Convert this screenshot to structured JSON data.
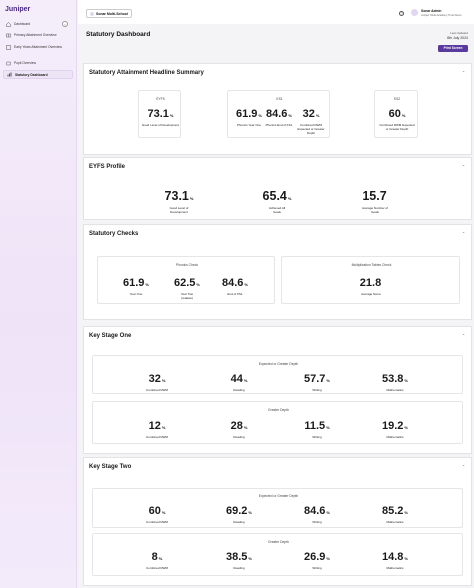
{
  "app": {
    "logo": "Juniper"
  },
  "sidebar": {
    "collapse_icon": "chevron-left-icon",
    "items": [
      {
        "label": "Dashboard",
        "icon": "home-icon"
      },
      {
        "label": "Primary Attainment Overview",
        "icon": "book-icon"
      },
      {
        "label": "Early Years Attainment Overview",
        "icon": "blocks-icon"
      },
      {
        "label": "Pupil Overview",
        "icon": "people-icon"
      },
      {
        "label": "Statutory Dashboard",
        "icon": "chart-icon"
      }
    ]
  },
  "header": {
    "school": "Sonar Multi-School",
    "user_name": "Sonar Admin",
    "user_org": "Juniper Multi-Academy Trust Demo"
  },
  "page": {
    "title": "Statutory Dashboard",
    "updated_label": "Last Updated",
    "updated_date": "8th July 2024",
    "print_label": "Print Screen"
  },
  "headline": {
    "title": "Statutory Attainment Headline Summary",
    "eyfs": {
      "caption": "EYFS",
      "stats": [
        {
          "value": "73.1",
          "unit": "%",
          "label": "Good Level of Development"
        }
      ]
    },
    "ks1": {
      "caption": "KS1",
      "stats": [
        {
          "value": "61.9",
          "unit": "%",
          "label": "Phonics Year One"
        },
        {
          "value": "84.6",
          "unit": "%",
          "label": "Phonics End of KS1"
        },
        {
          "value": "32",
          "unit": "%",
          "label": "Combined RWM Expected or Greater Depth"
        }
      ]
    },
    "ks2": {
      "caption": "KS2",
      "stats": [
        {
          "value": "60",
          "unit": "%",
          "label": "Combined RWM Expected or Greater Depth"
        }
      ]
    }
  },
  "eyfs_profile": {
    "title": "EYFS Profile",
    "stats": [
      {
        "value": "73.1",
        "unit": "%",
        "label": "Good Level of Development"
      },
      {
        "value": "65.4",
        "unit": "%",
        "label": "Achieved All Goals"
      },
      {
        "value": "15.7",
        "unit": "",
        "label": "Average Number of Goals"
      }
    ]
  },
  "statutory_checks": {
    "title": "Statutory Checks",
    "phonics": {
      "caption": "Phonics Check",
      "stats": [
        {
          "value": "61.9",
          "unit": "%",
          "label": "Year One"
        },
        {
          "value": "62.5",
          "unit": "%",
          "label": "Year Two (retakes)"
        },
        {
          "value": "84.6",
          "unit": "%",
          "label": "End of KS1"
        }
      ]
    },
    "multiplication": {
      "caption": "Multiplication Tables Check",
      "stats": [
        {
          "value": "21.8",
          "unit": "",
          "label": "Average Score"
        }
      ]
    }
  },
  "ks1": {
    "title": "Key Stage One",
    "expected": {
      "caption": "Expected or Greater Depth",
      "stats": [
        {
          "value": "32",
          "unit": "%",
          "label": "Combined RWM"
        },
        {
          "value": "44",
          "unit": "%",
          "label": "Reading"
        },
        {
          "value": "57.7",
          "unit": "%",
          "label": "Writing"
        },
        {
          "value": "53.8",
          "unit": "%",
          "label": "Mathematics"
        }
      ]
    },
    "greater": {
      "caption": "Greater Depth",
      "stats": [
        {
          "value": "12",
          "unit": "%",
          "label": "Combined RWM"
        },
        {
          "value": "28",
          "unit": "%",
          "label": "Reading"
        },
        {
          "value": "11.5",
          "unit": "%",
          "label": "Writing"
        },
        {
          "value": "19.2",
          "unit": "%",
          "label": "Mathematics"
        }
      ]
    }
  },
  "ks2": {
    "title": "Key Stage Two",
    "expected": {
      "caption": "Expected or Greater Depth",
      "stats": [
        {
          "value": "60",
          "unit": "%",
          "label": "Combined RWM"
        },
        {
          "value": "69.2",
          "unit": "%",
          "label": "Reading"
        },
        {
          "value": "84.6",
          "unit": "%",
          "label": "Writing"
        },
        {
          "value": "85.2",
          "unit": "%",
          "label": "Mathematics"
        }
      ]
    },
    "greater": {
      "caption": "Greater Depth",
      "stats": [
        {
          "value": "8",
          "unit": "%",
          "label": "Combined RWM"
        },
        {
          "value": "38.5",
          "unit": "%",
          "label": "Reading"
        },
        {
          "value": "26.9",
          "unit": "%",
          "label": "Writing"
        },
        {
          "value": "14.8",
          "unit": "%",
          "label": "Mathematics"
        }
      ]
    }
  }
}
